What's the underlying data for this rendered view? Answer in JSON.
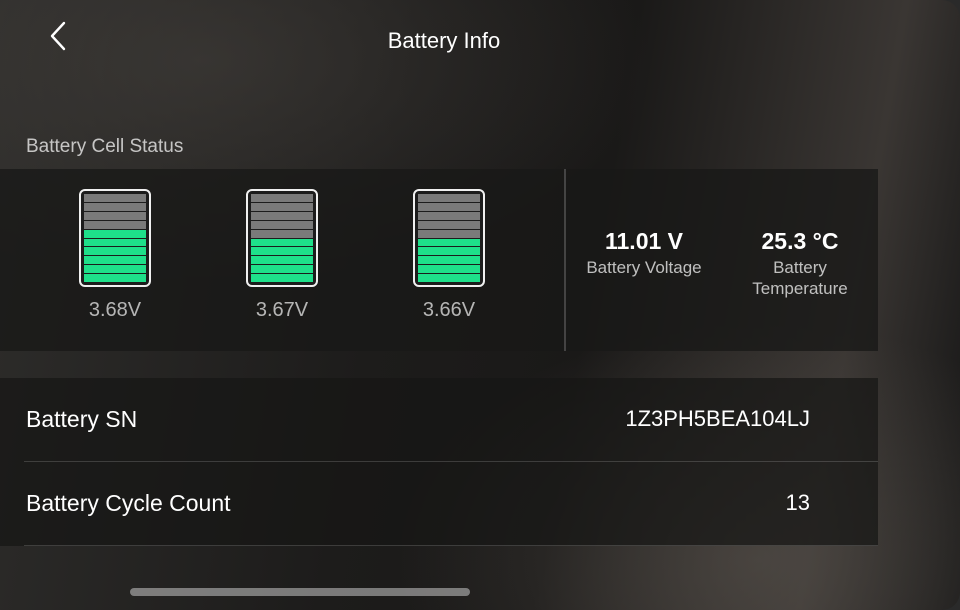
{
  "header": {
    "title": "Battery Info",
    "back_icon": "chevron-left-icon"
  },
  "cell_status": {
    "label": "Battery Cell Status",
    "cells": [
      {
        "voltage": "3.68V",
        "level": 0.6
      },
      {
        "voltage": "3.67V",
        "level": 0.5
      },
      {
        "voltage": "3.66V",
        "level": 0.5
      }
    ]
  },
  "summary": {
    "voltage_value": "11.01 V",
    "voltage_label": "Battery Voltage",
    "temperature_value": "25.3 °C",
    "temperature_label_line1": "Battery",
    "temperature_label_line2": "Temperature"
  },
  "details": {
    "sn_label": "Battery SN",
    "sn_value": "1Z3PH5BEA104LJ",
    "cycle_label": "Battery Cycle Count",
    "cycle_value": "13"
  },
  "colors": {
    "cell_fill": "#1ee08a",
    "cell_empty": "#7a7a7a"
  }
}
